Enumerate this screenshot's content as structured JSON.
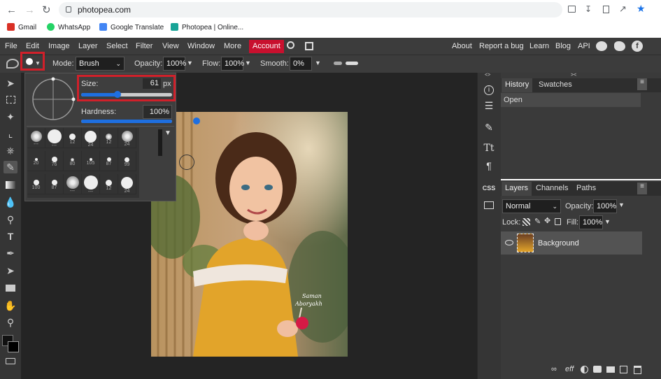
{
  "browser": {
    "url": "photopea.com",
    "bookmarks": [
      {
        "label": "Gmail",
        "icon": "gmail-icon",
        "color": "#d93025"
      },
      {
        "label": "WhatsApp",
        "icon": "whatsapp-icon",
        "color": "#25d366"
      },
      {
        "label": "Google Translate",
        "icon": "translate-icon",
        "color": "#4285f4"
      },
      {
        "label": "Photopea | Online...",
        "icon": "photopea-icon",
        "color": "#18a497"
      }
    ]
  },
  "menu": {
    "items": [
      "File",
      "Edit",
      "Image",
      "Layer",
      "Select",
      "Filter",
      "View",
      "Window",
      "More"
    ],
    "account": "Account",
    "right": [
      "About",
      "Report a bug",
      "Learn",
      "Blog",
      "API"
    ]
  },
  "options": {
    "mode_label": "Mode:",
    "mode_value": "Brush",
    "opacity_label": "Opacity:",
    "opacity_value": "100%",
    "flow_label": "Flow:",
    "flow_value": "100%",
    "smooth_label": "Smooth:",
    "smooth_value": "0%"
  },
  "brush_popup": {
    "size_label": "Size:",
    "size_value": "61",
    "size_unit": "px",
    "size_fraction": 0.4,
    "hardness_label": "Hardness:",
    "hardness_value": "100%",
    "hardness_fraction": 1.0,
    "presets": [
      {
        "label": "---",
        "d": 16,
        "soft": true
      },
      {
        "label": "---",
        "d": 20,
        "soft": false
      },
      {
        "label": "12",
        "d": 9,
        "soft": false
      },
      {
        "label": "24",
        "d": 17,
        "soft": false
      },
      {
        "label": "12",
        "d": 9,
        "soft": true
      },
      {
        "label": "24",
        "d": 16,
        "soft": true
      },
      {
        "label": "20",
        "d": 4,
        "soft": false
      },
      {
        "label": "76",
        "d": 8,
        "soft": false
      },
      {
        "label": "80",
        "d": 5,
        "soft": true
      },
      {
        "label": "105",
        "d": 4,
        "soft": false
      },
      {
        "label": "87",
        "d": 6,
        "soft": false
      },
      {
        "label": "99",
        "d": 7,
        "soft": false
      },
      {
        "label": "100",
        "d": 8,
        "soft": false
      },
      {
        "label": "87",
        "d": 8,
        "soft": false
      },
      {
        "label": "---",
        "d": 18,
        "soft": true
      },
      {
        "label": "---",
        "d": 20,
        "soft": false
      },
      {
        "label": "12",
        "d": 9,
        "soft": false
      },
      {
        "label": "24",
        "d": 17,
        "soft": false
      }
    ]
  },
  "history": {
    "tabs": [
      "History",
      "Swatches"
    ],
    "items": [
      "Open"
    ]
  },
  "layers": {
    "tabs": [
      "Layers",
      "Channels",
      "Paths"
    ],
    "blend_mode": "Normal",
    "opacity_label": "Opacity:",
    "opacity_value": "100%",
    "lock_label": "Lock:",
    "fill_label": "Fill:",
    "fill_value": "100%",
    "layer_name": "Background"
  },
  "image": {
    "watermark_line1": "Saman",
    "watermark_line2": "Aboryakh"
  },
  "colors": {
    "accent": "#d0202a",
    "slider": "#1e6fe0",
    "panel": "#3a3a3a"
  }
}
